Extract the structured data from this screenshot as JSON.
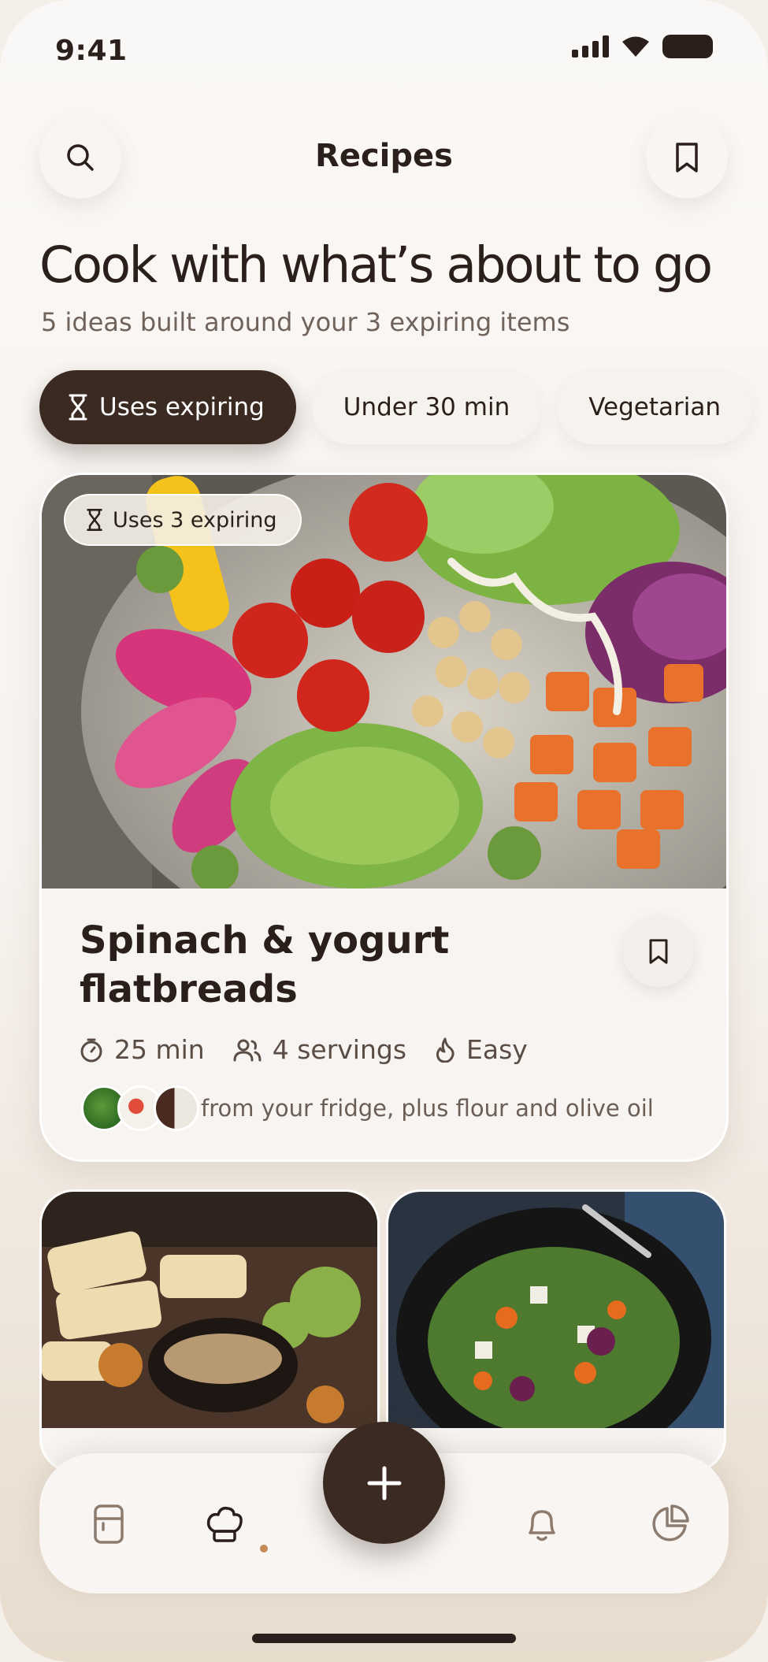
{
  "status_bar": {
    "time": "9:41"
  },
  "header": {
    "title": "Recipes"
  },
  "hero": {
    "headline": "Cook with what’s about to go",
    "subheadline": "5 ideas built around your 3 expiring items"
  },
  "filters": [
    {
      "label": "Uses expiring",
      "active": true
    },
    {
      "label": "Under 30 min",
      "active": false
    },
    {
      "label": "Vegetarian",
      "active": false
    }
  ],
  "featured": {
    "badge": "Uses 3 expiring",
    "title": "Spinach & yogurt flatbreads",
    "time": "25 min",
    "servings": "4 servings",
    "difficulty": "Easy",
    "fridge_note": "from your fridge, plus flour and olive oil"
  },
  "colors": {
    "accent": "#3b2a22",
    "dot": "#c48a57",
    "background": "#f7f3ef"
  },
  "tabbar": {
    "items": [
      "fridge-icon",
      "chef-hat-icon",
      "add-icon",
      "bell-icon",
      "pie-chart-icon"
    ],
    "active": "chef-hat-icon"
  }
}
